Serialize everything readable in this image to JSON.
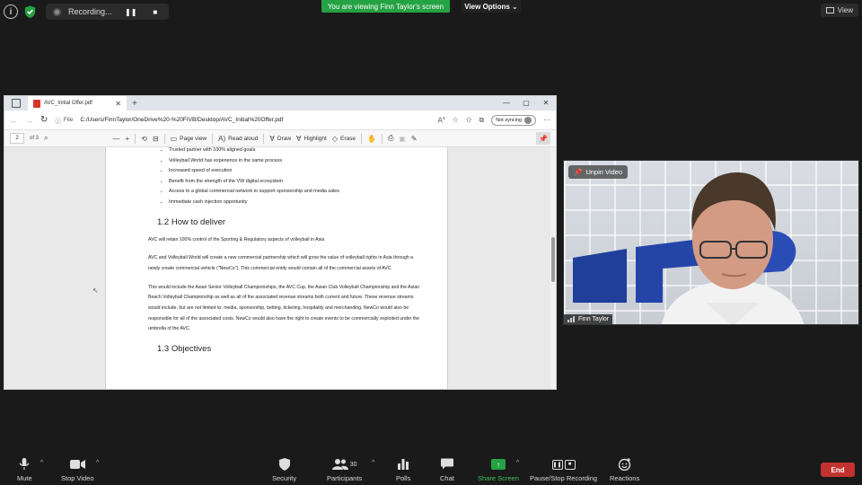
{
  "zoom": {
    "recording_label": "Recording...",
    "recording_pause": "❚❚",
    "recording_stop": "■",
    "viewing_banner": "You are viewing Finn Taylor's screen",
    "view_options_label": "View Options ⌄",
    "view_label": "View",
    "unpin_label": "Unpin Video",
    "participant_name": "Finn Taylor",
    "toolbar": {
      "mute": "Mute",
      "stop_video": "Stop Video",
      "security": "Security",
      "participants": "Participants",
      "participant_count": "30",
      "polls": "Polls",
      "chat": "Chat",
      "share_screen": "Share Screen",
      "pause_stop_recording": "Pause/Stop Recording",
      "reactions": "Reactions",
      "end": "End"
    },
    "colors": {
      "green": "#25a243",
      "end_red": "#c2322f"
    }
  },
  "browser": {
    "tab_title": "AVC_Initial Offer.pdf",
    "file_label": "File",
    "url": "C:/Users/FinnTaylor/OneDrive%20-%20FIVB/Desktop/AVC_Initial%20Offer.pdf",
    "sync_label": "Not syncing",
    "pdf_toolbar": {
      "page_current": "2",
      "page_total": "of 3",
      "page_view": "Page view",
      "read_aloud": "Read aloud",
      "draw": "Draw",
      "highlight": "Highlight",
      "erase": "Erase"
    }
  },
  "document": {
    "bullets": [
      "Trusted partner with 100% aligned goals",
      "Volleyball World has experience in the same process",
      "Increased speed of execution",
      "Benefit from the strength of the VW digital ecosystem",
      "Access to a global commercial network to support sponsorship and media sales",
      "Immediate cash injection opportunity"
    ],
    "heading_1": "1.2 How to deliver",
    "para_1": "AVC will retain 100% control of the Sporting & Regulatory aspects of volleyball in Asia",
    "para_2": "AVC and Volleyball World will create a new commercial partnership which will grow the value of volleyball rights in Asia through a newly create commercial vehicle (\"NewCo\"). This commercial entity would contain all of the commercial assets of AVC.",
    "para_3": "This would include the Asian Senior Volleyball Championships, the AVC Cup, the Asian Club Volleyball Championship and the Asian Beach Volleyball Championship as well as all of the associated revenue streams both current and future. These revenue streams would include, but are not limited to: media, sponsorship, betting, ticketing, hospitality and merchanding. NewCo would also be responsible for all of the associated costs. NewCo would also have the right to create events to be commercially exploited under the umbrella of the AVC.",
    "heading_2": "1.3 Objectives"
  }
}
